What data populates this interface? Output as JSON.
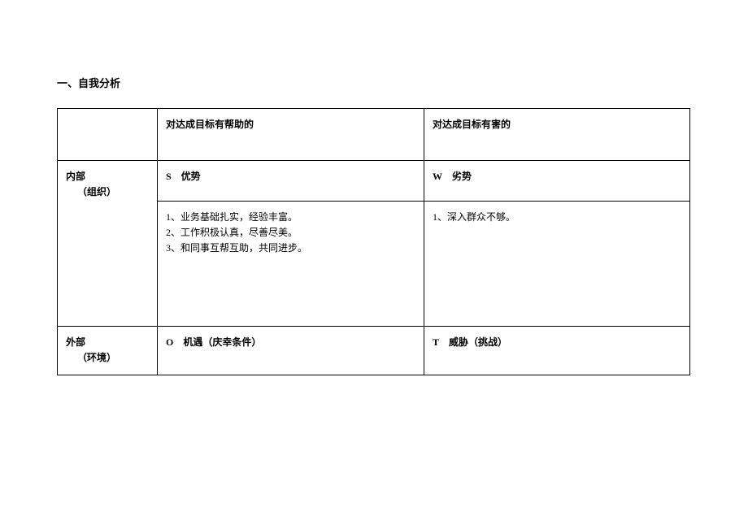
{
  "title": "一、自我分析",
  "header": {
    "col_helpful": "对达成目标有帮助的",
    "col_harmful": "对达成目标有害的"
  },
  "rows": {
    "internal": {
      "label_line1": "内部",
      "label_line2": "（组织）",
      "s_label": "S 优势",
      "w_label": "W 劣势",
      "s_items": [
        "1、业务基础扎实，经验丰富。",
        "2、工作积极认真，尽善尽美。",
        "3、和同事互帮互助，共同进步。"
      ],
      "w_items": [
        "1、深入群众不够。"
      ]
    },
    "external": {
      "label_line1": "外部",
      "label_line2": "（环境）",
      "o_label": "O 机遇（庆幸条件）",
      "t_label": "T 威胁（挑战）"
    }
  }
}
